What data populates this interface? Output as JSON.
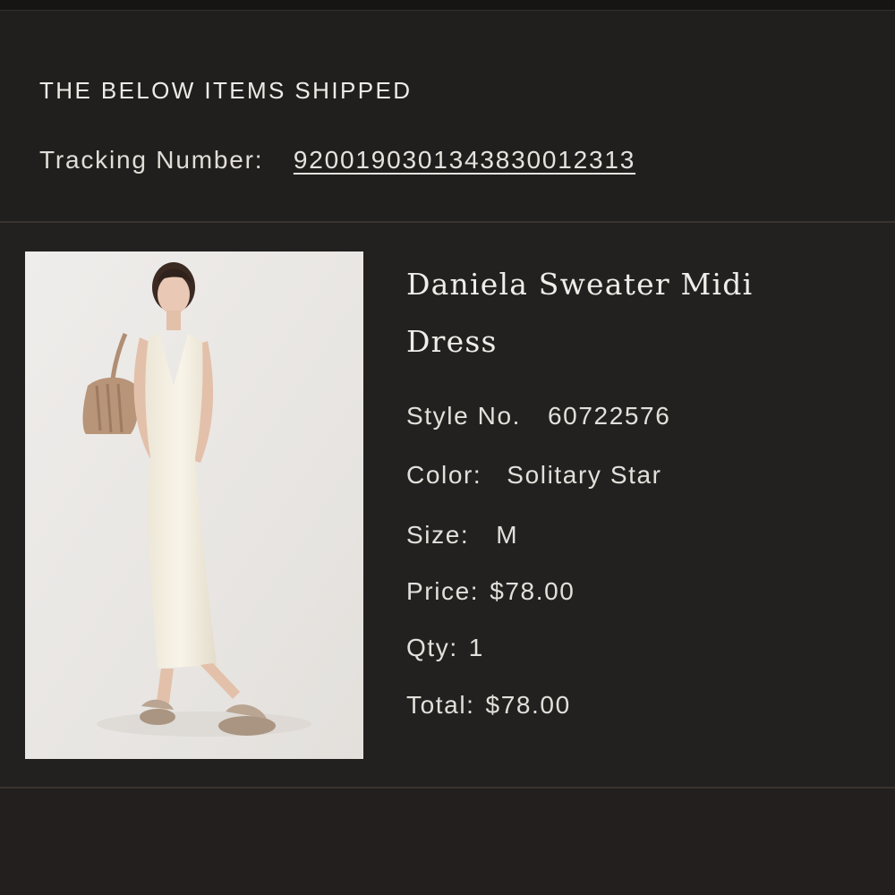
{
  "shipment": {
    "title": "THE BELOW ITEMS SHIPPED",
    "tracking_label": "Tracking Number:",
    "tracking_number": "9200190301343830012313"
  },
  "item": {
    "name": "Daniela Sweater Midi Dress",
    "style_label": "Style No.",
    "style_value": "60722576",
    "color_label": "Color:",
    "color_value": "Solitary Star",
    "size_label": "Size:",
    "size_value": "M",
    "price_label": "Price:",
    "price_value": "$78.00",
    "qty_label": "Qty:",
    "qty_value": "1",
    "total_label": "Total:",
    "total_value": "$78.00"
  },
  "colors": {
    "background": "#222020",
    "text": "#e6e3df",
    "divider": "#3a3430",
    "image_backdrop": "#ece9e6"
  }
}
